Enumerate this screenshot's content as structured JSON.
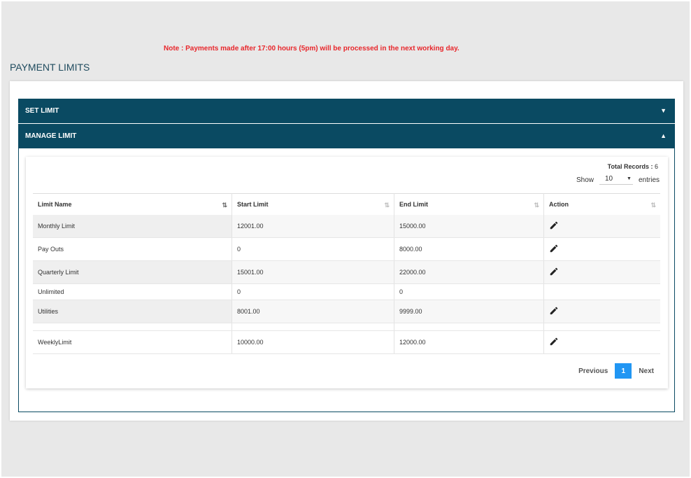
{
  "note": "Note : Payments made after 17:00 hours (5pm) will be processed in the next working day.",
  "page_title": "PAYMENT LIMITS",
  "accordion": {
    "set_limit": {
      "label": "SET LIMIT",
      "caret": "▼"
    },
    "manage_limit": {
      "label": "MANAGE LIMIT",
      "caret": "▲"
    }
  },
  "records": {
    "total_label": "Total Records :",
    "total_value": "6"
  },
  "show_entries": {
    "show": "Show",
    "value": "10",
    "entries": "entries"
  },
  "table": {
    "headers": [
      "Limit Name",
      "Start Limit",
      "End Limit",
      "Action"
    ],
    "rows": [
      {
        "name": "Monthly Limit",
        "start": "12001.00",
        "end": "15000.00",
        "editable": true
      },
      {
        "name": "Pay Outs",
        "start": "0",
        "end": "8000.00",
        "editable": true
      },
      {
        "name": "Quarterly Limit",
        "start": "15001.00",
        "end": "22000.00",
        "editable": true
      },
      {
        "name": "Unlimited",
        "start": "0",
        "end": "0",
        "editable": false
      },
      {
        "name": "Utilities",
        "start": "8001.00",
        "end": "9999.00",
        "editable": true
      },
      {
        "name": "WeeklyLimit",
        "start": "10000.00",
        "end": "12000.00",
        "editable": true
      }
    ]
  },
  "pagination": {
    "previous": "Previous",
    "current": "1",
    "next": "Next"
  },
  "colors": {
    "accent": "#0a4a62",
    "note": "#e8262b",
    "page_button": "#2196f3"
  }
}
